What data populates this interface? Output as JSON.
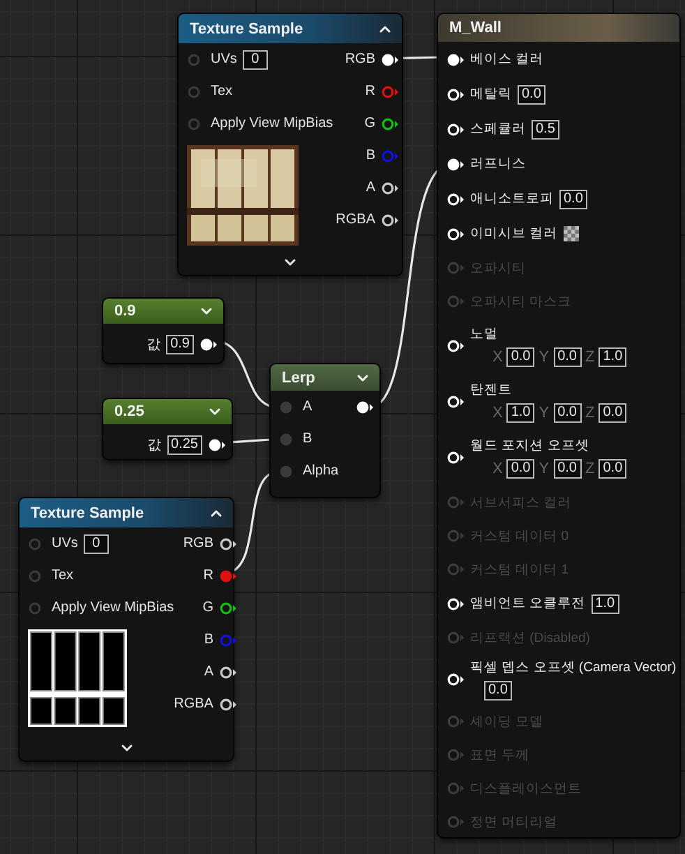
{
  "texture_samples": [
    {
      "title": "Texture Sample",
      "inputs": [
        {
          "label": "UVs",
          "value": "0",
          "connected": false
        },
        {
          "label": "Tex",
          "connected": false
        },
        {
          "label": "Apply View MipBias",
          "connected": false
        }
      ],
      "outputs": [
        {
          "label": "RGB",
          "color": "#ffffff",
          "connected": true
        },
        {
          "label": "R",
          "color": "#e01010",
          "connected": false
        },
        {
          "label": "G",
          "color": "#10c010",
          "connected": false
        },
        {
          "label": "B",
          "color": "#1010e0",
          "connected": false
        },
        {
          "label": "A",
          "color": "#c8c8c8",
          "connected": false
        },
        {
          "label": "RGBA",
          "color": "#c8c8c8",
          "connected": false
        }
      ]
    },
    {
      "title": "Texture Sample",
      "inputs": [
        {
          "label": "UVs",
          "value": "0",
          "connected": false
        },
        {
          "label": "Tex",
          "connected": false
        },
        {
          "label": "Apply View MipBias",
          "connected": false
        }
      ],
      "outputs": [
        {
          "label": "RGB",
          "color": "#c8c8c8",
          "connected": false
        },
        {
          "label": "R",
          "color": "#e01010",
          "connected": true
        },
        {
          "label": "G",
          "color": "#10c010",
          "connected": false
        },
        {
          "label": "B",
          "color": "#1010e0",
          "connected": false
        },
        {
          "label": "A",
          "color": "#c8c8c8",
          "connected": false
        },
        {
          "label": "RGBA",
          "color": "#c8c8c8",
          "connected": false
        }
      ]
    }
  ],
  "constants": [
    {
      "title": "0.9",
      "label": "값",
      "value": "0.9",
      "output_connected": true
    },
    {
      "title": "0.25",
      "label": "값",
      "value": "0.25",
      "output_connected": true
    }
  ],
  "lerp": {
    "title": "Lerp",
    "inputs": [
      {
        "label": "A",
        "connected": true
      },
      {
        "label": "B",
        "connected": true
      },
      {
        "label": "Alpha",
        "connected": true
      }
    ],
    "output_connected": true
  },
  "material": {
    "title": "M_Wall",
    "inputs": [
      {
        "kind": "plain",
        "label": "베이스 컬러",
        "enabled": true,
        "connected": true
      },
      {
        "kind": "scalar",
        "label": "메탈릭",
        "value": "0.0",
        "enabled": true,
        "connected": false
      },
      {
        "kind": "scalar",
        "label": "스페큘러",
        "value": "0.5",
        "enabled": true,
        "connected": false
      },
      {
        "kind": "plain",
        "label": "러프니스",
        "enabled": true,
        "connected": true
      },
      {
        "kind": "scalar",
        "label": "애니소트로피",
        "value": "0.0",
        "enabled": true,
        "connected": false
      },
      {
        "kind": "texture",
        "label": "이미시브 컬러",
        "enabled": true,
        "connected": false
      },
      {
        "kind": "plain",
        "label": "오파시티",
        "enabled": false,
        "connected": false
      },
      {
        "kind": "plain",
        "label": "오파시티 마스크",
        "enabled": false,
        "connected": false
      },
      {
        "kind": "vector",
        "label": "노멀",
        "enabled": true,
        "connected": false,
        "axes": [
          {
            "axis": "X",
            "value": "0.0"
          },
          {
            "axis": "Y",
            "value": "0.0"
          },
          {
            "axis": "Z",
            "value": "1.0"
          }
        ]
      },
      {
        "kind": "vector",
        "label": "탄젠트",
        "enabled": true,
        "connected": false,
        "axes": [
          {
            "axis": "X",
            "value": "1.0"
          },
          {
            "axis": "Y",
            "value": "0.0"
          },
          {
            "axis": "Z",
            "value": "0.0"
          }
        ]
      },
      {
        "kind": "vector",
        "label": "월드 포지션 오프셋",
        "enabled": true,
        "connected": false,
        "axes": [
          {
            "axis": "X",
            "value": "0.0"
          },
          {
            "axis": "Y",
            "value": "0.0"
          },
          {
            "axis": "Z",
            "value": "0.0"
          }
        ]
      },
      {
        "kind": "plain",
        "label": "서브서피스 컬러",
        "enabled": false,
        "connected": false
      },
      {
        "kind": "plain",
        "label": "커스텀 데이터 0",
        "enabled": false,
        "connected": false
      },
      {
        "kind": "plain",
        "label": "커스텀 데이터 1",
        "enabled": false,
        "connected": false
      },
      {
        "kind": "scalar",
        "label": "앰비언트 오클루전",
        "value": "1.0",
        "enabled": true,
        "connected": false
      },
      {
        "kind": "plain",
        "label": "리프랙션 (Disabled)",
        "enabled": false,
        "connected": false
      },
      {
        "kind": "wrapped",
        "label": "픽셀 뎁스 오프셋 (Camera Vector)",
        "value": "0.0",
        "enabled": true,
        "connected": false
      },
      {
        "kind": "plain",
        "label": "셰이딩 모델",
        "enabled": false,
        "connected": false
      },
      {
        "kind": "plain",
        "label": "표면 두께",
        "enabled": false,
        "connected": false
      },
      {
        "kind": "plain",
        "label": "디스플레이스먼트",
        "enabled": false,
        "connected": false
      },
      {
        "kind": "plain",
        "label": "정면 머티리얼",
        "enabled": false,
        "connected": false
      }
    ]
  }
}
